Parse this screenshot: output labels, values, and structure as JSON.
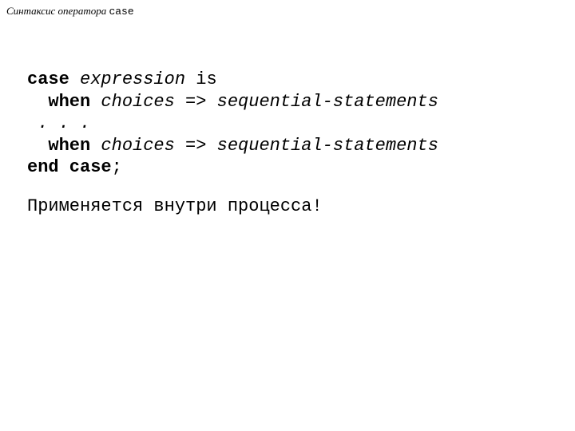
{
  "title": {
    "prefix": "Синтаксис оператора ",
    "keyword": "case"
  },
  "code": {
    "l1_kw": "case",
    "l1_expr": "expression",
    "l1_is": " is",
    "indent": "  ",
    "l2_kw": "when",
    "l2_rest": "choices => sequential-statements",
    "l3": " . . .",
    "l4_kw": "when",
    "l4_rest": "choices => sequential-statements",
    "l5_kw": "end case",
    "l5_semi": ";"
  },
  "note": "Применяется внутри процесса!"
}
